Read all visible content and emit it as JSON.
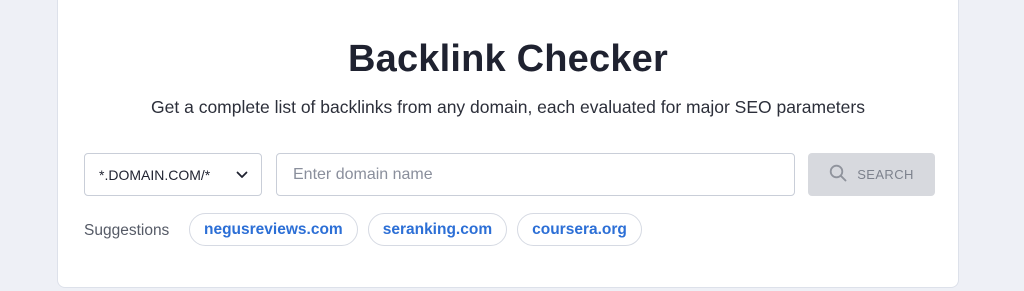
{
  "header": {
    "title": "Backlink Checker",
    "subtitle": "Get a complete list of backlinks from any domain, each evaluated for major SEO parameters"
  },
  "form": {
    "mode_select": {
      "selected": "*.DOMAIN.COM/*",
      "icon": "chevron-down-icon"
    },
    "domain_input": {
      "value": "",
      "placeholder": "Enter domain name"
    },
    "search_button": {
      "label": "SEARCH",
      "icon": "search-icon",
      "state": "disabled"
    }
  },
  "suggestions": {
    "label": "Suggestions",
    "items": [
      {
        "label": "negusreviews.com"
      },
      {
        "label": "seranking.com"
      },
      {
        "label": "coursera.org"
      }
    ]
  },
  "colors": {
    "page_bg": "#eef0f6",
    "card_bg": "#ffffff",
    "link": "#2c6fd6",
    "button_disabled_bg": "#d7d9de",
    "button_disabled_text": "#7d828d"
  }
}
